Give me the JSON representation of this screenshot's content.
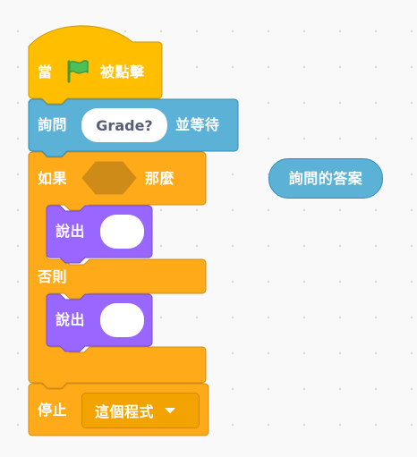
{
  "hat_block": {
    "label_when": "當",
    "label_clicked": "被點擊",
    "icon": "green-flag-icon"
  },
  "ask_block": {
    "label_ask": "詢問",
    "input_value": "Grade?",
    "label_wait": "並等待"
  },
  "if_else_block": {
    "label_if": "如果",
    "label_then": "那麼",
    "label_else": "否則"
  },
  "say_block_1": {
    "label": "說出",
    "input_value": ""
  },
  "say_block_2": {
    "label": "說出",
    "input_value": ""
  },
  "stop_block": {
    "label": "停止",
    "selected_option": "這個程式",
    "icon": "dropdown-arrow-icon"
  },
  "answer_reporter": {
    "label": "詢問的答案"
  },
  "colors": {
    "events": "#FFBF00",
    "sensing": "#5CB1D6",
    "control": "#FFAB19",
    "looks": "#9966FF"
  }
}
